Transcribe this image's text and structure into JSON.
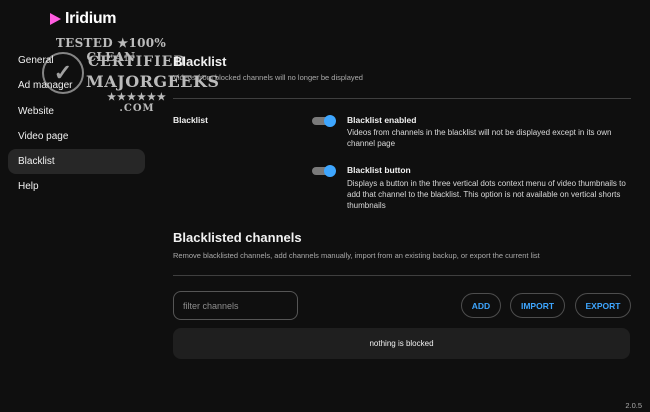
{
  "app": {
    "name": "Iridium",
    "version": "2.0.5"
  },
  "badge": {
    "line1": "TESTED ★100% CLEAN",
    "line2": "CERTIFIED",
    "line3": "MAJORGEEKS",
    "line4": "★★★★★★ .COM"
  },
  "nav": {
    "items": [
      {
        "label": "General"
      },
      {
        "label": "Ad manager"
      },
      {
        "label": "Website"
      },
      {
        "label": "Video page"
      },
      {
        "label": "Blacklist"
      },
      {
        "label": "Help"
      }
    ],
    "active": "Blacklist"
  },
  "blacklist": {
    "title": "Blacklist",
    "subtitle": "Videos from blocked channels will no longer be displayed",
    "section_label": "Blacklist",
    "options": [
      {
        "title": "Blacklist enabled",
        "enabled": true,
        "description": "Videos from channels in the blacklist will not be displayed except in its own channel page"
      },
      {
        "title": "Blacklist button",
        "enabled": true,
        "description": "Displays a button in the three vertical dots context menu of video thumbnails to add that channel to the blacklist. This option is not available on vertical shorts thumbnails"
      }
    ]
  },
  "channels": {
    "title": "Blacklisted channels",
    "subtitle": "Remove blacklisted channels, add channels manually, import from an existing backup, or export the current list",
    "filter_placeholder": "filter channels",
    "filter_value": "",
    "add_label": "ADD",
    "import_label": "IMPORT",
    "export_label": "EXPORT",
    "empty_message": "nothing is blocked"
  },
  "colors": {
    "accent": "#3ea6ff",
    "logo": "#ff5de0",
    "background": "#0f0f0f",
    "active_nav": "#272727"
  }
}
